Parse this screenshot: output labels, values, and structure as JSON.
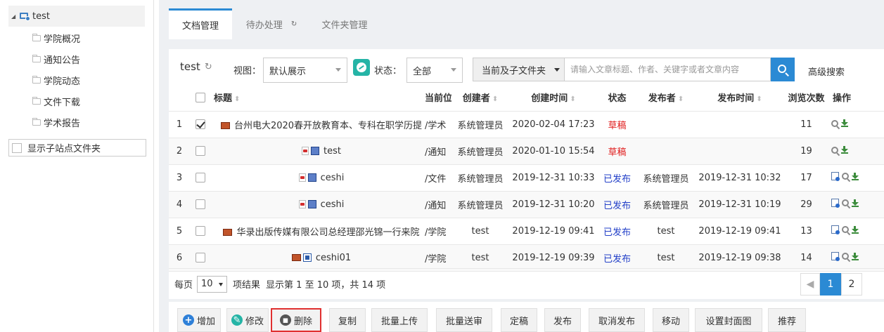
{
  "tree": {
    "root_label": "test",
    "items": [
      "学院概况",
      "通知公告",
      "学院动态",
      "文件下载",
      "学术报告"
    ],
    "show_sub_label": "显示子站点文件夹"
  },
  "tabs": [
    {
      "label": "文档管理",
      "active": true
    },
    {
      "label": "待办处理",
      "active": false
    },
    {
      "label": "文件夹管理",
      "active": false
    }
  ],
  "filter": {
    "site_title": "test",
    "view_label": "视图：",
    "view_value": "默认展示",
    "status_label": "状态：",
    "status_value": "全部",
    "scope_value": "当前及子文件夹",
    "search_placeholder": "请输入文章标题、作者、关键字或者文章内容",
    "advanced_search": "高级搜索"
  },
  "table": {
    "headers": [
      "标题",
      "当前位",
      "创建者",
      "创建时间",
      "状态",
      "发布者",
      "发布时间",
      "浏览次数",
      "操作"
    ],
    "rows": [
      {
        "no": "1",
        "checked": true,
        "icons": [
          "image"
        ],
        "title": "台州电大2020春开放教育本、专科在职学历提",
        "path": "/学术",
        "creator": "系统管理员",
        "created": "2020-02-04 17:23",
        "status": "草稿",
        "status_type": "draft",
        "publisher": "",
        "published": "",
        "views": "11",
        "ops": [
          "preview",
          "download"
        ]
      },
      {
        "no": "2",
        "checked": false,
        "icons": [
          "pdf",
          "film"
        ],
        "title": "test",
        "path": "/通知",
        "creator": "系统管理员",
        "created": "2020-01-10 15:54",
        "status": "草稿",
        "status_type": "draft",
        "publisher": "",
        "published": "",
        "views": "19",
        "ops": [
          "preview",
          "download"
        ]
      },
      {
        "no": "3",
        "checked": false,
        "icons": [
          "pdf",
          "film"
        ],
        "title": "ceshi",
        "path": "/文件",
        "creator": "系统管理员",
        "created": "2019-12-31 10:33",
        "status": "已发布",
        "status_type": "published",
        "publisher": "系统管理员",
        "published": "2019-12-31 10:32",
        "views": "17",
        "ops": [
          "doc",
          "preview",
          "download"
        ]
      },
      {
        "no": "4",
        "checked": false,
        "icons": [
          "pdf",
          "film"
        ],
        "title": "ceshi",
        "path": "/通知",
        "creator": "系统管理员",
        "created": "2019-12-31 10:20",
        "status": "已发布",
        "status_type": "published",
        "publisher": "系统管理员",
        "published": "2019-12-31 10:19",
        "views": "29",
        "ops": [
          "doc",
          "preview",
          "download"
        ]
      },
      {
        "no": "5",
        "checked": false,
        "icons": [
          "image"
        ],
        "title": "华录出版传媒有限公司总经理邵光锦一行来院",
        "path": "/学院",
        "creator": "test",
        "created": "2019-12-19 09:41",
        "status": "已发布",
        "status_type": "published",
        "publisher": "test",
        "published": "2019-12-19 09:41",
        "views": "13",
        "ops": [
          "doc",
          "preview",
          "download"
        ]
      },
      {
        "no": "6",
        "checked": false,
        "icons": [
          "image",
          "word"
        ],
        "title": "ceshi01",
        "path": "/学院",
        "creator": "test",
        "created": "2019-12-19 09:39",
        "status": "已发布",
        "status_type": "published",
        "publisher": "test",
        "published": "2019-12-19 09:38",
        "views": "14",
        "ops": [
          "doc",
          "preview",
          "download"
        ]
      }
    ]
  },
  "pager": {
    "per_page_label": "每页",
    "per_page_value": "10",
    "result_label": "项结果",
    "summary": "显示第 1 至 10 项，共 14 项",
    "pages": [
      "1",
      "2"
    ],
    "current_page": "1"
  },
  "toolbar": {
    "add": "增加",
    "edit": "修改",
    "delete": "删除",
    "copy": "复制",
    "batch_upload": "批量上传",
    "batch_submit": "批量送审",
    "finalize": "定稿",
    "publish": "发布",
    "unpublish": "取消发布",
    "move": "移动",
    "set_cover": "设置封面图",
    "recommend": "推荐"
  },
  "colors": {
    "accent": "#2b8ad4",
    "draft": "#e02020",
    "published": "#2340c8",
    "highlight": "#e03030"
  }
}
